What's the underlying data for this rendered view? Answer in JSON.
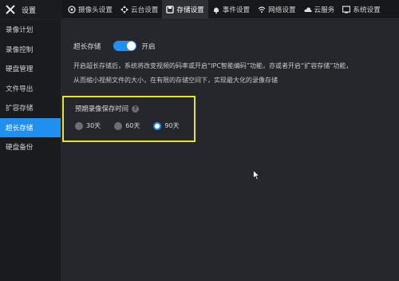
{
  "header": {
    "brand_label": "设置",
    "tabs": [
      {
        "label": "摄像头设置",
        "icon": "camera-icon"
      },
      {
        "label": "云台设置",
        "icon": "ptz-icon"
      },
      {
        "label": "存储设置",
        "icon": "storage-icon",
        "active": true
      },
      {
        "label": "事件设置",
        "icon": "bell-icon"
      },
      {
        "label": "网络设置",
        "icon": "wifi-icon"
      },
      {
        "label": "云服务",
        "icon": "cloud-icon"
      },
      {
        "label": "系统设置",
        "icon": "system-icon"
      }
    ]
  },
  "sidebar": {
    "items": [
      {
        "label": "录像计划"
      },
      {
        "label": "录像控制"
      },
      {
        "label": "硬盘管理"
      },
      {
        "label": "文件导出"
      },
      {
        "label": "扩容存储"
      },
      {
        "label": "超长存储",
        "active": true
      },
      {
        "label": "硬盘备份"
      }
    ]
  },
  "main": {
    "switch_label": "超长存储",
    "switch_state": "开启",
    "switch_on": true,
    "desc_line1": "开启超长存储后，系统将改变视频的码率或开启“IPC智能编码”功能，亦或者开启“扩容存储”功能，",
    "desc_line2": "从而缩小视频文件的大小，在有限的存储空间下，实现最大化的录像存储",
    "retention": {
      "title": "预期录像保存时间",
      "help_icon": "?",
      "options": [
        {
          "label": "30天",
          "selected": false
        },
        {
          "label": "60天",
          "selected": false
        },
        {
          "label": "90天",
          "selected": true
        }
      ]
    }
  },
  "colors": {
    "accent": "#1f8ff0",
    "highlight_box": "#e3e62a",
    "background": "#25272c",
    "sidebar": "#1a1b1f"
  }
}
